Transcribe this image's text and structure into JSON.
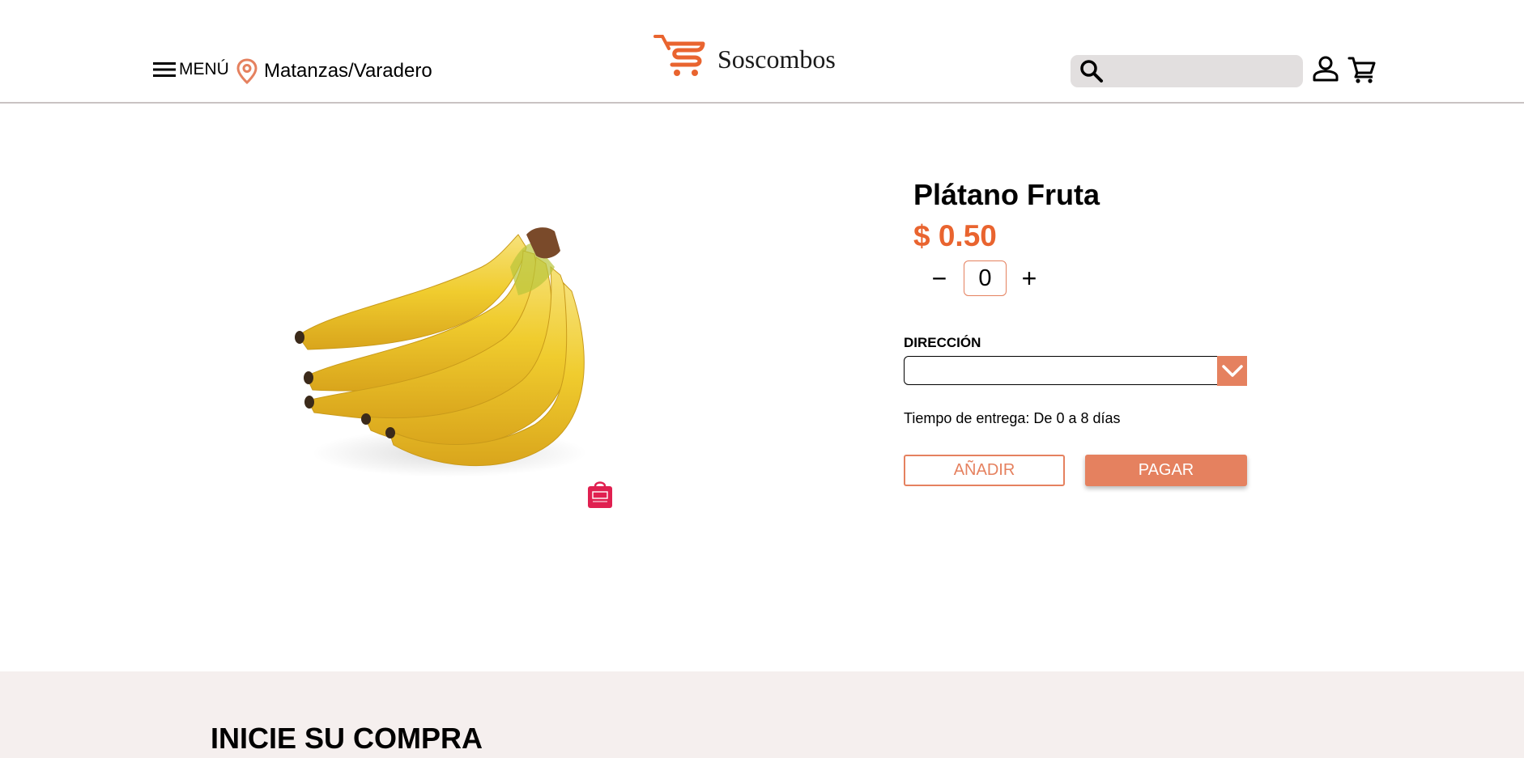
{
  "header": {
    "menu_label": "MENÚ",
    "location": "Matanzas/Varadero",
    "brand": "Soscombos",
    "search_placeholder": ""
  },
  "product": {
    "name": "Plátano Fruta",
    "price": "$ 0.50",
    "quantity": "0",
    "qty_minus": "−",
    "qty_plus": "+",
    "address_label": "DIRECCIÓN",
    "address_value": "",
    "delivery_time": "Tiempo de entrega: De 0 a 8 días",
    "add_button": "AÑADIR",
    "pay_button": "PAGAR"
  },
  "footer": {
    "heading": "INICIE SU COMPRA"
  },
  "colors": {
    "accent": "#e5815f",
    "price": "#e9642f",
    "footer_bg": "#f5efee",
    "search_bg": "#e2dfdf"
  },
  "icons": [
    "hamburger-icon",
    "location-pin-icon",
    "cart-logo-icon",
    "search-icon",
    "user-icon",
    "shopping-cart-icon",
    "chevron-down-icon",
    "shopping-bag-icon"
  ]
}
